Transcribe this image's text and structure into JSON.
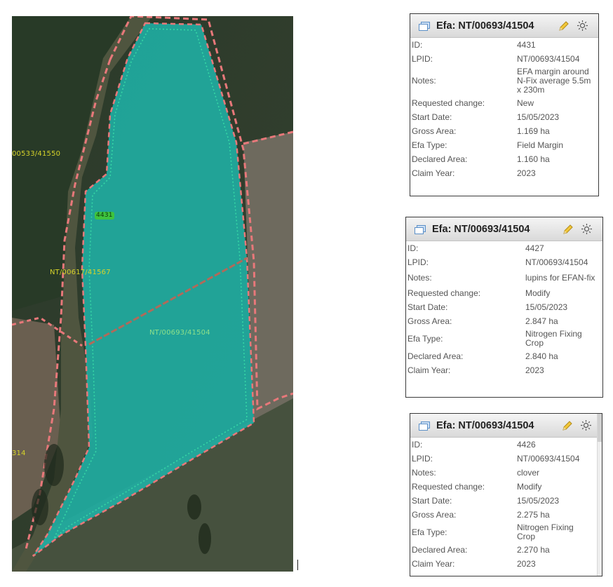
{
  "map": {
    "labels": {
      "parcel_left": "00533/41550",
      "efa_id": "4431",
      "parcel_west": "NT/00617/41567",
      "parcel_main": "NT/00693/41504",
      "parcel_bottom_left": "314"
    },
    "colors": {
      "efa_fill": "#1fb5aa",
      "parcel_boundary": "#e8787a",
      "efa_boundary": "#36d6a6"
    }
  },
  "panels": [
    {
      "title": "Efa: NT/00693/41504",
      "rows": [
        {
          "label": "ID:",
          "value": "4431"
        },
        {
          "label": "LPID:",
          "value": "NT/00693/41504"
        },
        {
          "label": "Notes:",
          "value": "EFA margin around N-Fix average 5.5m x 230m"
        },
        {
          "label": "Requested change:",
          "value": "New"
        },
        {
          "label": "Start Date:",
          "value": "15/05/2023"
        },
        {
          "label": "Gross Area:",
          "value": "1.169 ha"
        },
        {
          "label": "Efa Type:",
          "value": "Field Margin"
        },
        {
          "label": "Declared Area:",
          "value": "1.160 ha"
        },
        {
          "label": "Claim Year:",
          "value": "2023"
        }
      ]
    },
    {
      "title": "Efa: NT/00693/41504",
      "rows": [
        {
          "label": "ID:",
          "value": "4427"
        },
        {
          "label": "LPID:",
          "value": "NT/00693/41504"
        },
        {
          "label": "Notes:",
          "value": "lupins for EFAN-fix"
        },
        {
          "label": "Requested change:",
          "value": "Modify"
        },
        {
          "label": "Start Date:",
          "value": "15/05/2023"
        },
        {
          "label": "Gross Area:",
          "value": "2.847 ha"
        },
        {
          "label": "Efa Type:",
          "value": "Nitrogen Fixing Crop"
        },
        {
          "label": "Declared Area:",
          "value": "2.840 ha"
        },
        {
          "label": "Claim Year:",
          "value": "2023"
        }
      ]
    },
    {
      "title": "Efa: NT/00693/41504",
      "rows": [
        {
          "label": "ID:",
          "value": "4426"
        },
        {
          "label": "LPID:",
          "value": "NT/00693/41504"
        },
        {
          "label": "Notes:",
          "value": "clover"
        },
        {
          "label": "Requested change:",
          "value": "Modify"
        },
        {
          "label": "Start Date:",
          "value": "15/05/2023"
        },
        {
          "label": "Gross Area:",
          "value": "2.275 ha"
        },
        {
          "label": "Efa Type:",
          "value": "Nitrogen Fixing Crop"
        },
        {
          "label": "Declared Area:",
          "value": "2.270 ha"
        },
        {
          "label": "Claim Year:",
          "value": "2023"
        }
      ]
    }
  ],
  "icons": {
    "header_left": "window-stack-icon",
    "edit": "pencil-icon",
    "highlight": "sun-icon"
  }
}
